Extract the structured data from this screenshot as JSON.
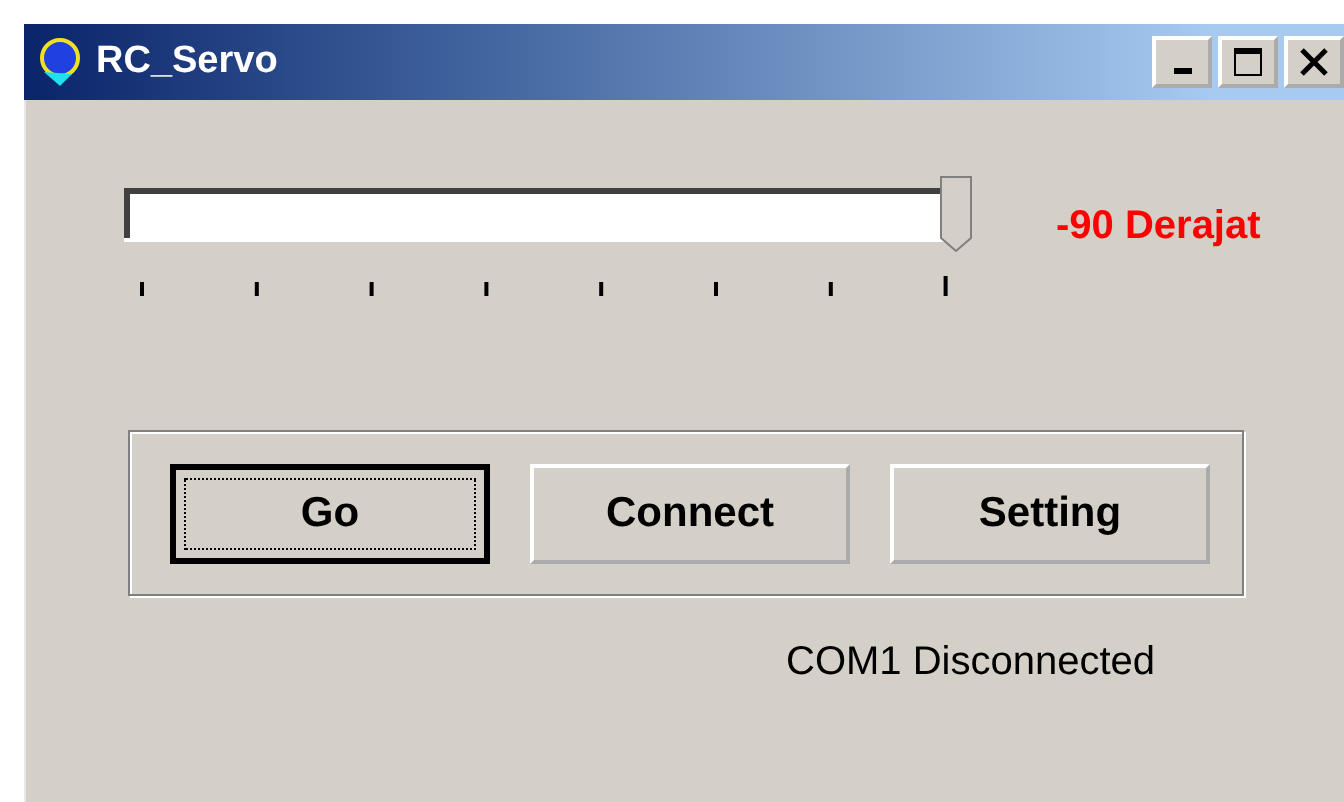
{
  "window": {
    "title": "RC_Servo"
  },
  "slider": {
    "level": 1,
    "reading": "-90 Derajat"
  },
  "buttons": [
    {
      "label": "Go",
      "focused": true
    },
    {
      "label": "Connect",
      "focused": false
    },
    {
      "label": "Setting",
      "focused": false
    }
  ],
  "status": "COM1 Disconnected"
}
